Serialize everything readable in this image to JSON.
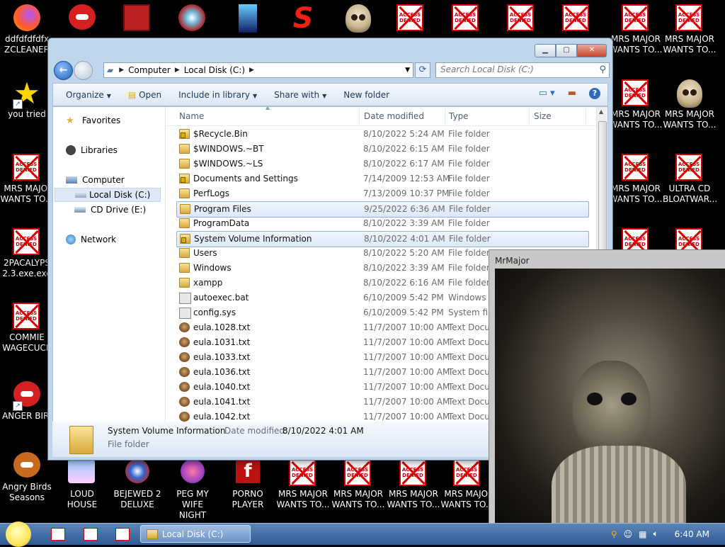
{
  "desktop_icons_left": [
    {
      "label": "ddfdfdfdfx\nZCLEANER"
    },
    {
      "label": "you tried"
    },
    {
      "label": "MRS MAJOI\nWANTS TO..."
    },
    {
      "label": "2PACALYPS\n2.3.exe.exe"
    },
    {
      "label": "COMMIE\nWAGECUCK"
    },
    {
      "label": "ANGER BIRI"
    },
    {
      "label": "Angry Birds\nSeasons"
    }
  ],
  "desktop_icons_right": [
    {
      "label": "MRS MAJOR\nWANTS TO..."
    },
    {
      "label": "MRS MAJOR\nWANTS TO..."
    },
    {
      "label": "MRS MAJOR\nWANTS TO..."
    },
    {
      "label": "MRS MAJOR\nWANTS TO..."
    },
    {
      "label": "MRS MAJOR\nWANTS TO..."
    },
    {
      "label": "ULTRA CD\nBLOATWAR..."
    }
  ],
  "desktop_icons_bottom": [
    {
      "label": "LOUD HOUSE"
    },
    {
      "label": "BEJEWED 2\nDELUXE"
    },
    {
      "label": "PEG MY WIFE\nNIGHT"
    },
    {
      "label": "PORNO\nPLAYER"
    },
    {
      "label": "MRS MAJOR\nWANTS TO..."
    },
    {
      "label": "MRS MAJOR\nWANTS TO..."
    },
    {
      "label": "MRS MAJOR\nWANTS TO..."
    },
    {
      "label": "MRS MAJOI\nWANTS TO..."
    }
  ],
  "denied_text": "ACCESS\nDENIED",
  "explorer": {
    "address": {
      "root": "Computer",
      "current": "Local Disk (C:)"
    },
    "search_placeholder": "Search Local Disk (C:)",
    "toolbar": {
      "organize": "Organize",
      "open": "Open",
      "include": "Include in library",
      "share": "Share with",
      "new_folder": "New folder"
    },
    "nav": {
      "favorites": "Favorites",
      "libraries": "Libraries",
      "computer": "Computer",
      "local_disk": "Local Disk (C:)",
      "cd_drive": "CD Drive (E:)",
      "network": "Network"
    },
    "columns": {
      "name": "Name",
      "date": "Date modified",
      "type": "Type",
      "size": "Size"
    },
    "files": [
      {
        "name": "$Recycle.Bin",
        "date": "8/10/2022 5:24 AM",
        "type": "File folder",
        "icon": "locked-folder-icon",
        "selected": false
      },
      {
        "name": "$WINDOWS.~BT",
        "date": "8/10/2022 6:15 AM",
        "type": "File folder",
        "icon": "folder-icon",
        "selected": false
      },
      {
        "name": "$WINDOWS.~LS",
        "date": "8/10/2022 6:17 AM",
        "type": "File folder",
        "icon": "folder-icon",
        "selected": false
      },
      {
        "name": "Documents and Settings",
        "date": "7/14/2009 12:53 AM",
        "type": "File folder",
        "icon": "locked-folder-icon",
        "selected": false
      },
      {
        "name": "PerfLogs",
        "date": "7/13/2009 10:37 PM",
        "type": "File folder",
        "icon": "folder-icon",
        "selected": false
      },
      {
        "name": "Program Files",
        "date": "9/25/2022 6:36 AM",
        "type": "File folder",
        "icon": "folder-icon",
        "selected": true
      },
      {
        "name": "ProgramData",
        "date": "8/10/2022 3:39 AM",
        "type": "File folder",
        "icon": "folder-icon",
        "selected": false
      },
      {
        "name": "System Volume Information",
        "date": "8/10/2022 4:01 AM",
        "type": "File folder",
        "icon": "locked-folder-icon",
        "selected": true
      },
      {
        "name": "Users",
        "date": "8/10/2022 5:20 AM",
        "type": "File folder",
        "icon": "folder-icon",
        "selected": false
      },
      {
        "name": "Windows",
        "date": "8/10/2022 3:39 AM",
        "type": "File folder",
        "icon": "folder-icon",
        "selected": false
      },
      {
        "name": "xampp",
        "date": "8/10/2022 6:16 AM",
        "type": "File folder",
        "icon": "folder-icon",
        "selected": false
      },
      {
        "name": "autoexec.bat",
        "date": "6/10/2009 5:42 PM",
        "type": "Windows Batch File",
        "icon": "batch-file-icon",
        "selected": false
      },
      {
        "name": "config.sys",
        "date": "6/10/2009 5:42 PM",
        "type": "System file",
        "icon": "system-file-icon",
        "selected": false
      },
      {
        "name": "eula.1028.txt",
        "date": "11/7/2007 10:00 AM",
        "type": "Text Document",
        "icon": "text-file-icon",
        "selected": false
      },
      {
        "name": "eula.1031.txt",
        "date": "11/7/2007 10:00 AM",
        "type": "Text Document",
        "icon": "text-file-icon",
        "selected": false
      },
      {
        "name": "eula.1033.txt",
        "date": "11/7/2007 10:00 AM",
        "type": "Text Document",
        "icon": "text-file-icon",
        "selected": false
      },
      {
        "name": "eula.1036.txt",
        "date": "11/7/2007 10:00 AM",
        "type": "Text Document",
        "icon": "text-file-icon",
        "selected": false
      },
      {
        "name": "eula.1040.txt",
        "date": "11/7/2007 10:00 AM",
        "type": "Text Document",
        "icon": "text-file-icon",
        "selected": false
      },
      {
        "name": "eula.1041.txt",
        "date": "11/7/2007 10:00 AM",
        "type": "Text Document",
        "icon": "text-file-icon",
        "selected": false
      },
      {
        "name": "eula.1042.txt",
        "date": "11/7/2007 10:00 AM",
        "type": "Text Document",
        "icon": "text-file-icon",
        "selected": false
      }
    ],
    "details": {
      "name": "System Volume Information",
      "modified_label": "Date modified:",
      "modified": "8/10/2022 4:01 AM",
      "type": "File folder"
    }
  },
  "popup": {
    "title": "MrMajor"
  },
  "taskbar": {
    "task_label": "Local Disk (C:)",
    "clock": "6:40 AM"
  }
}
